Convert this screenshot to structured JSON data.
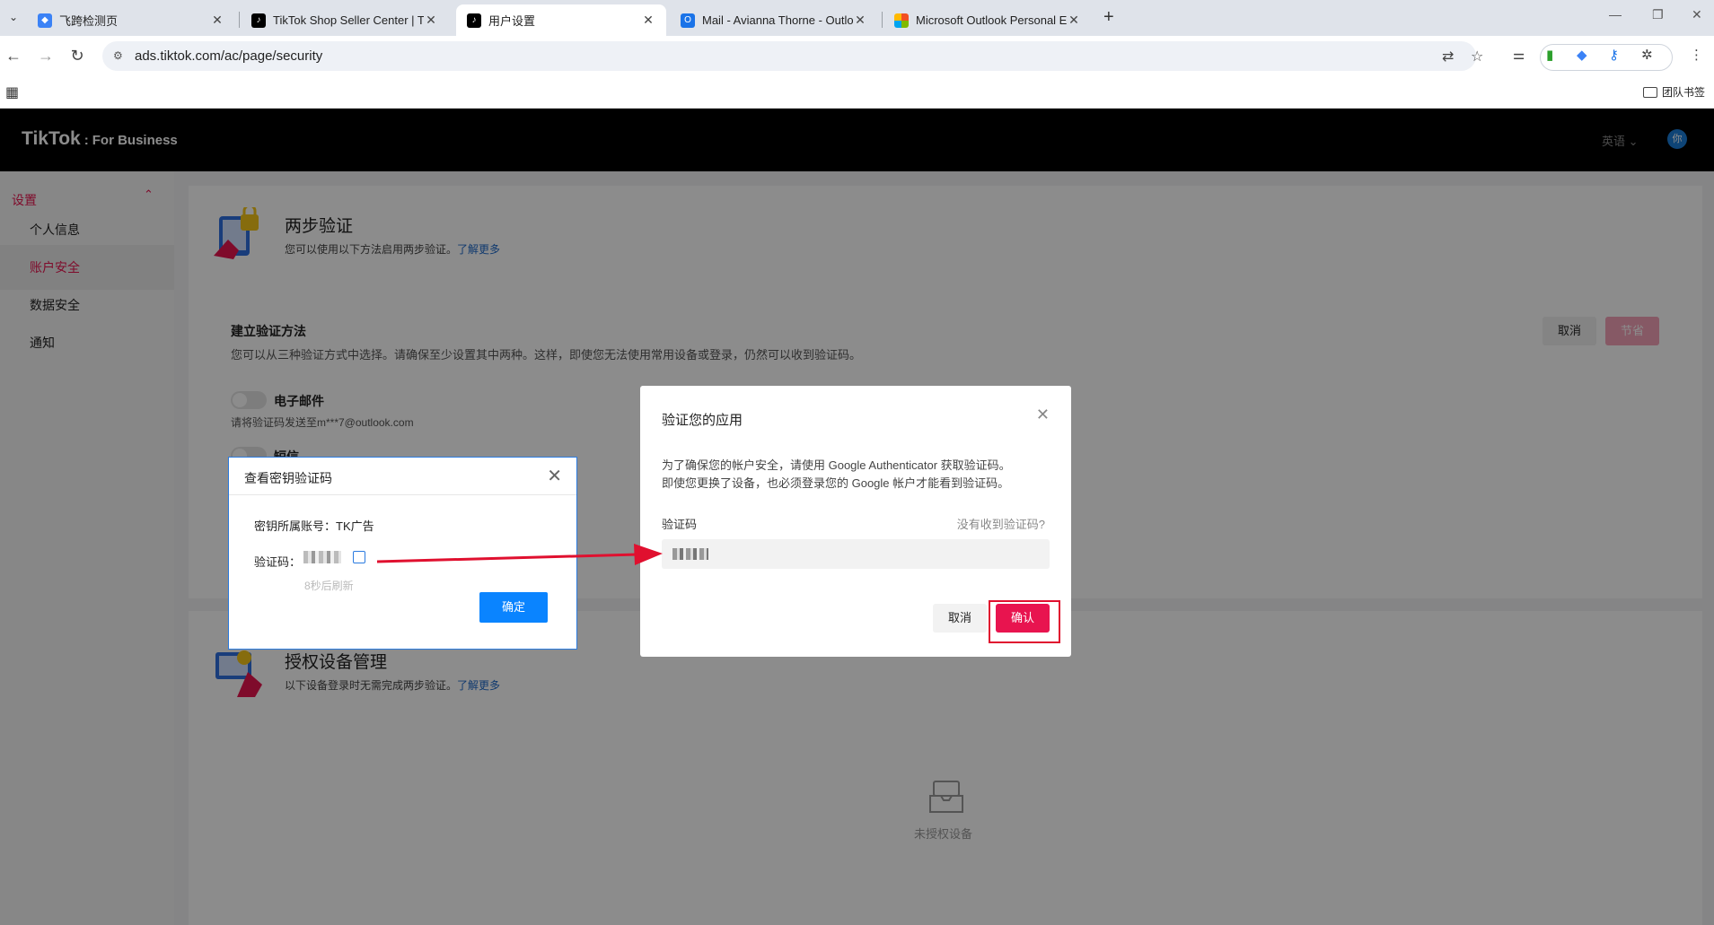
{
  "browser": {
    "tabs": [
      {
        "title": "飞跨检测页",
        "favicon": "shield-icon",
        "color": "#3b82f6"
      },
      {
        "title": "TikTok Shop Seller Center | Ti",
        "favicon": "tiktok-icon",
        "color": "#000000"
      },
      {
        "title": "用户设置",
        "favicon": "tiktok-icon",
        "color": "#000000"
      },
      {
        "title": "Mail - Avianna Thorne - Outlo",
        "favicon": "outlook-icon",
        "color": "#1a73e8"
      },
      {
        "title": "Microsoft Outlook Personal E",
        "favicon": "microsoft-icon",
        "color": "#f25022"
      }
    ],
    "url": "ads.tiktok.com/ac/page/security",
    "bookmark_folder": "团队书签"
  },
  "header": {
    "logo_main": "TikTok",
    "logo_sub": "For Business",
    "language": "英语",
    "avatar_initial": "你"
  },
  "sidebar": {
    "heading": "设置",
    "items": [
      "个人信息",
      "账户安全",
      "数据安全",
      "通知"
    ],
    "active_index": 1,
    "accent_color": "#e8144f"
  },
  "two_step": {
    "title": "两步验证",
    "subtitle": "您可以使用以下方法启用两步验证。",
    "learn_more": "了解更多",
    "method_title": "建立验证方法",
    "method_desc": "您可以从三种验证方式中选择。请确保至少设置其中两种。这样，即使您无法使用常用设备或登录，仍然可以收到验证码。",
    "email_label": "电子邮件",
    "email_sub": "请将验证码发送至m***7@outlook.com",
    "sms_label": "短信",
    "cancel": "取消",
    "save": "节省"
  },
  "devices": {
    "title": "授权设备管理",
    "subtitle": "以下设备登录时无需完成两步验证。",
    "learn_more": "了解更多",
    "empty": "未授权设备"
  },
  "secret_dialog": {
    "title": "查看密钥验证码",
    "owner_label": "密钥所属账号：",
    "owner_value": "TK广告",
    "code_label": "验证码：",
    "refresh": "8秒后刷新",
    "ok": "确定"
  },
  "verify_dialog": {
    "title": "验证您的应用",
    "desc_line1": "为了确保您的帐户安全，请使用 Google Authenticator 获取验证码。",
    "desc_line2": "即使您更换了设备，也必须登录您的 Google 帐户才能看到验证码。",
    "code_label": "验证码",
    "no_code": "没有收到验证码?",
    "cancel": "取消",
    "confirm": "确认"
  }
}
